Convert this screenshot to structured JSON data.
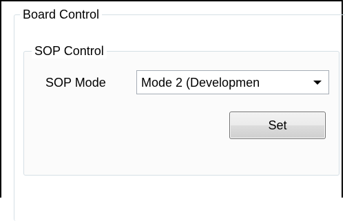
{
  "board_control": {
    "title": "Board Control",
    "sop_control": {
      "title": "SOP Control",
      "mode_label": "SOP Mode",
      "mode_value": "Mode 2 (Developmen",
      "set_label": "Set"
    }
  }
}
